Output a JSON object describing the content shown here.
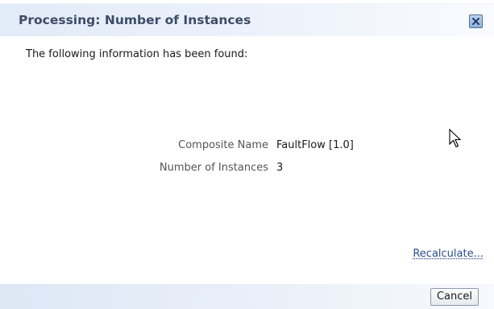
{
  "dialog": {
    "title": "Processing: Number of Instances",
    "close_icon": "close-x-icon"
  },
  "content": {
    "intro": "The following information has been found:",
    "rows": [
      {
        "label": "Composite Name",
        "value": "FaultFlow [1.0]"
      },
      {
        "label": "Number of Instances",
        "value": "3"
      }
    ],
    "recalculate_link": "Recalculate..."
  },
  "footer": {
    "cancel_label": "Cancel"
  },
  "colors": {
    "title_text": "#3c4d69",
    "bar_background": "#e2ebf8",
    "link": "#2a4f8c"
  }
}
